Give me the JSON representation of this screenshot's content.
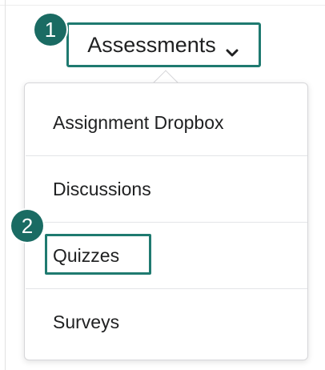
{
  "trigger": {
    "label": "Assessments",
    "icon": "chevron-down-icon"
  },
  "badges": {
    "step1": "1",
    "step2": "2"
  },
  "menu": {
    "items": [
      {
        "label": "Assignment Dropbox"
      },
      {
        "label": "Discussions"
      },
      {
        "label": "Quizzes"
      },
      {
        "label": "Surveys"
      }
    ]
  },
  "colors": {
    "highlight_border": "#1f7a70",
    "badge_fill": "#1a6b63",
    "text": "#202122"
  }
}
